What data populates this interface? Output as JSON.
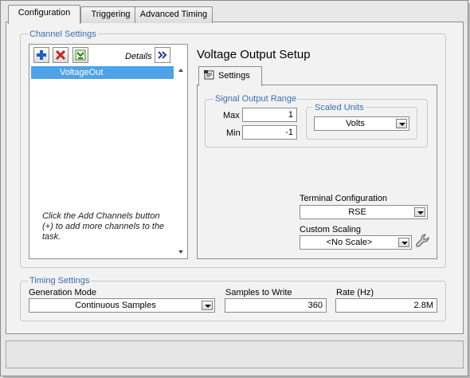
{
  "tabs": [
    {
      "label": "Configuration"
    },
    {
      "label": "Triggering"
    },
    {
      "label": "Advanced Timing"
    }
  ],
  "channel_settings": {
    "title": "Channel Settings",
    "details_label": "Details",
    "channels": [
      "VoltageOut"
    ],
    "hint": "Click the Add Channels button (+) to add more channels to the task."
  },
  "voltage_setup": {
    "title": "Voltage Output Setup",
    "settings_tab": "Settings",
    "signal_range_title": "Signal Output Range",
    "max_label": "Max",
    "max_value": "1",
    "min_label": "Min",
    "min_value": "-1",
    "scaled_units_title": "Scaled Units",
    "scaled_units_value": "Volts",
    "terminal_config_label": "Terminal Configuration",
    "terminal_config_value": "RSE",
    "custom_scaling_label": "Custom Scaling",
    "custom_scaling_value": "<No Scale>"
  },
  "timing": {
    "title": "Timing Settings",
    "generation_mode_label": "Generation Mode",
    "generation_mode_value": "Continuous Samples",
    "samples_label": "Samples to Write",
    "samples_value": "360",
    "rate_label": "Rate (Hz)",
    "rate_value": "2.8M"
  },
  "icons": {
    "add": "plus-icon",
    "remove": "x-icon",
    "arrange": "channel-arrange-icon",
    "expand": "double-chevron-right-icon",
    "settings": "settings-form-icon",
    "wrench": "wrench-icon"
  },
  "colors": {
    "group_title": "#3a6fb4",
    "selection": "#4ea3e6",
    "add_icon": "#1d5fc6",
    "remove_icon": "#cc2222"
  }
}
